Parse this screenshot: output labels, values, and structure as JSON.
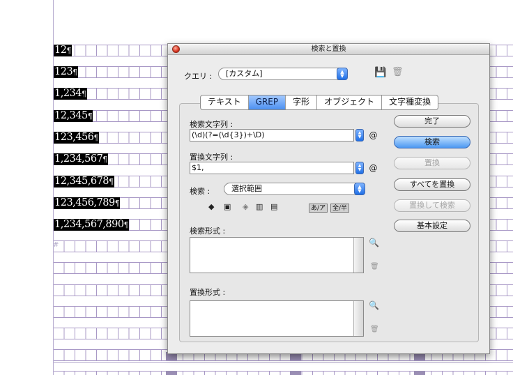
{
  "document": {
    "numbers": [
      "12",
      "123",
      "1,234",
      "12,345",
      "123,456",
      "1,234,567",
      "12,345,678",
      "123,456,789",
      "1,234,567,890"
    ],
    "pilcrow": "¶",
    "hash": "#"
  },
  "dialog": {
    "title": "検索と置換",
    "query_label": "クエリ :",
    "query_value": "[カスタム]",
    "tabs": [
      {
        "label": "テキスト",
        "active": false
      },
      {
        "label": "GREP",
        "active": true
      },
      {
        "label": "字形",
        "active": false
      },
      {
        "label": "オブジェクト",
        "active": false
      },
      {
        "label": "文字種変換",
        "active": false
      }
    ],
    "find_label": "検索文字列 :",
    "find_value": "(\\d)(?=(\\d{3})+\\D)",
    "change_label": "置換文字列 :",
    "change_value": "$1,",
    "at_symbol": "@",
    "search_label": "検索 :",
    "search_value": "選択範囲",
    "kana_toggle": "あ/ア",
    "width_toggle": "全/半",
    "find_format_label": "検索形式 :",
    "change_format_label": "置換形式 :",
    "buttons": {
      "done": "完了",
      "find": "検索",
      "change": "置換",
      "change_all": "すべてを置換",
      "change_find": "置換して検索",
      "more_options": "基本設定"
    },
    "icons": {
      "save": "save-query-icon",
      "delete": "trash-icon",
      "format_edit": "magnifier-a-icon",
      "format_clear": "trash-icon"
    }
  }
}
